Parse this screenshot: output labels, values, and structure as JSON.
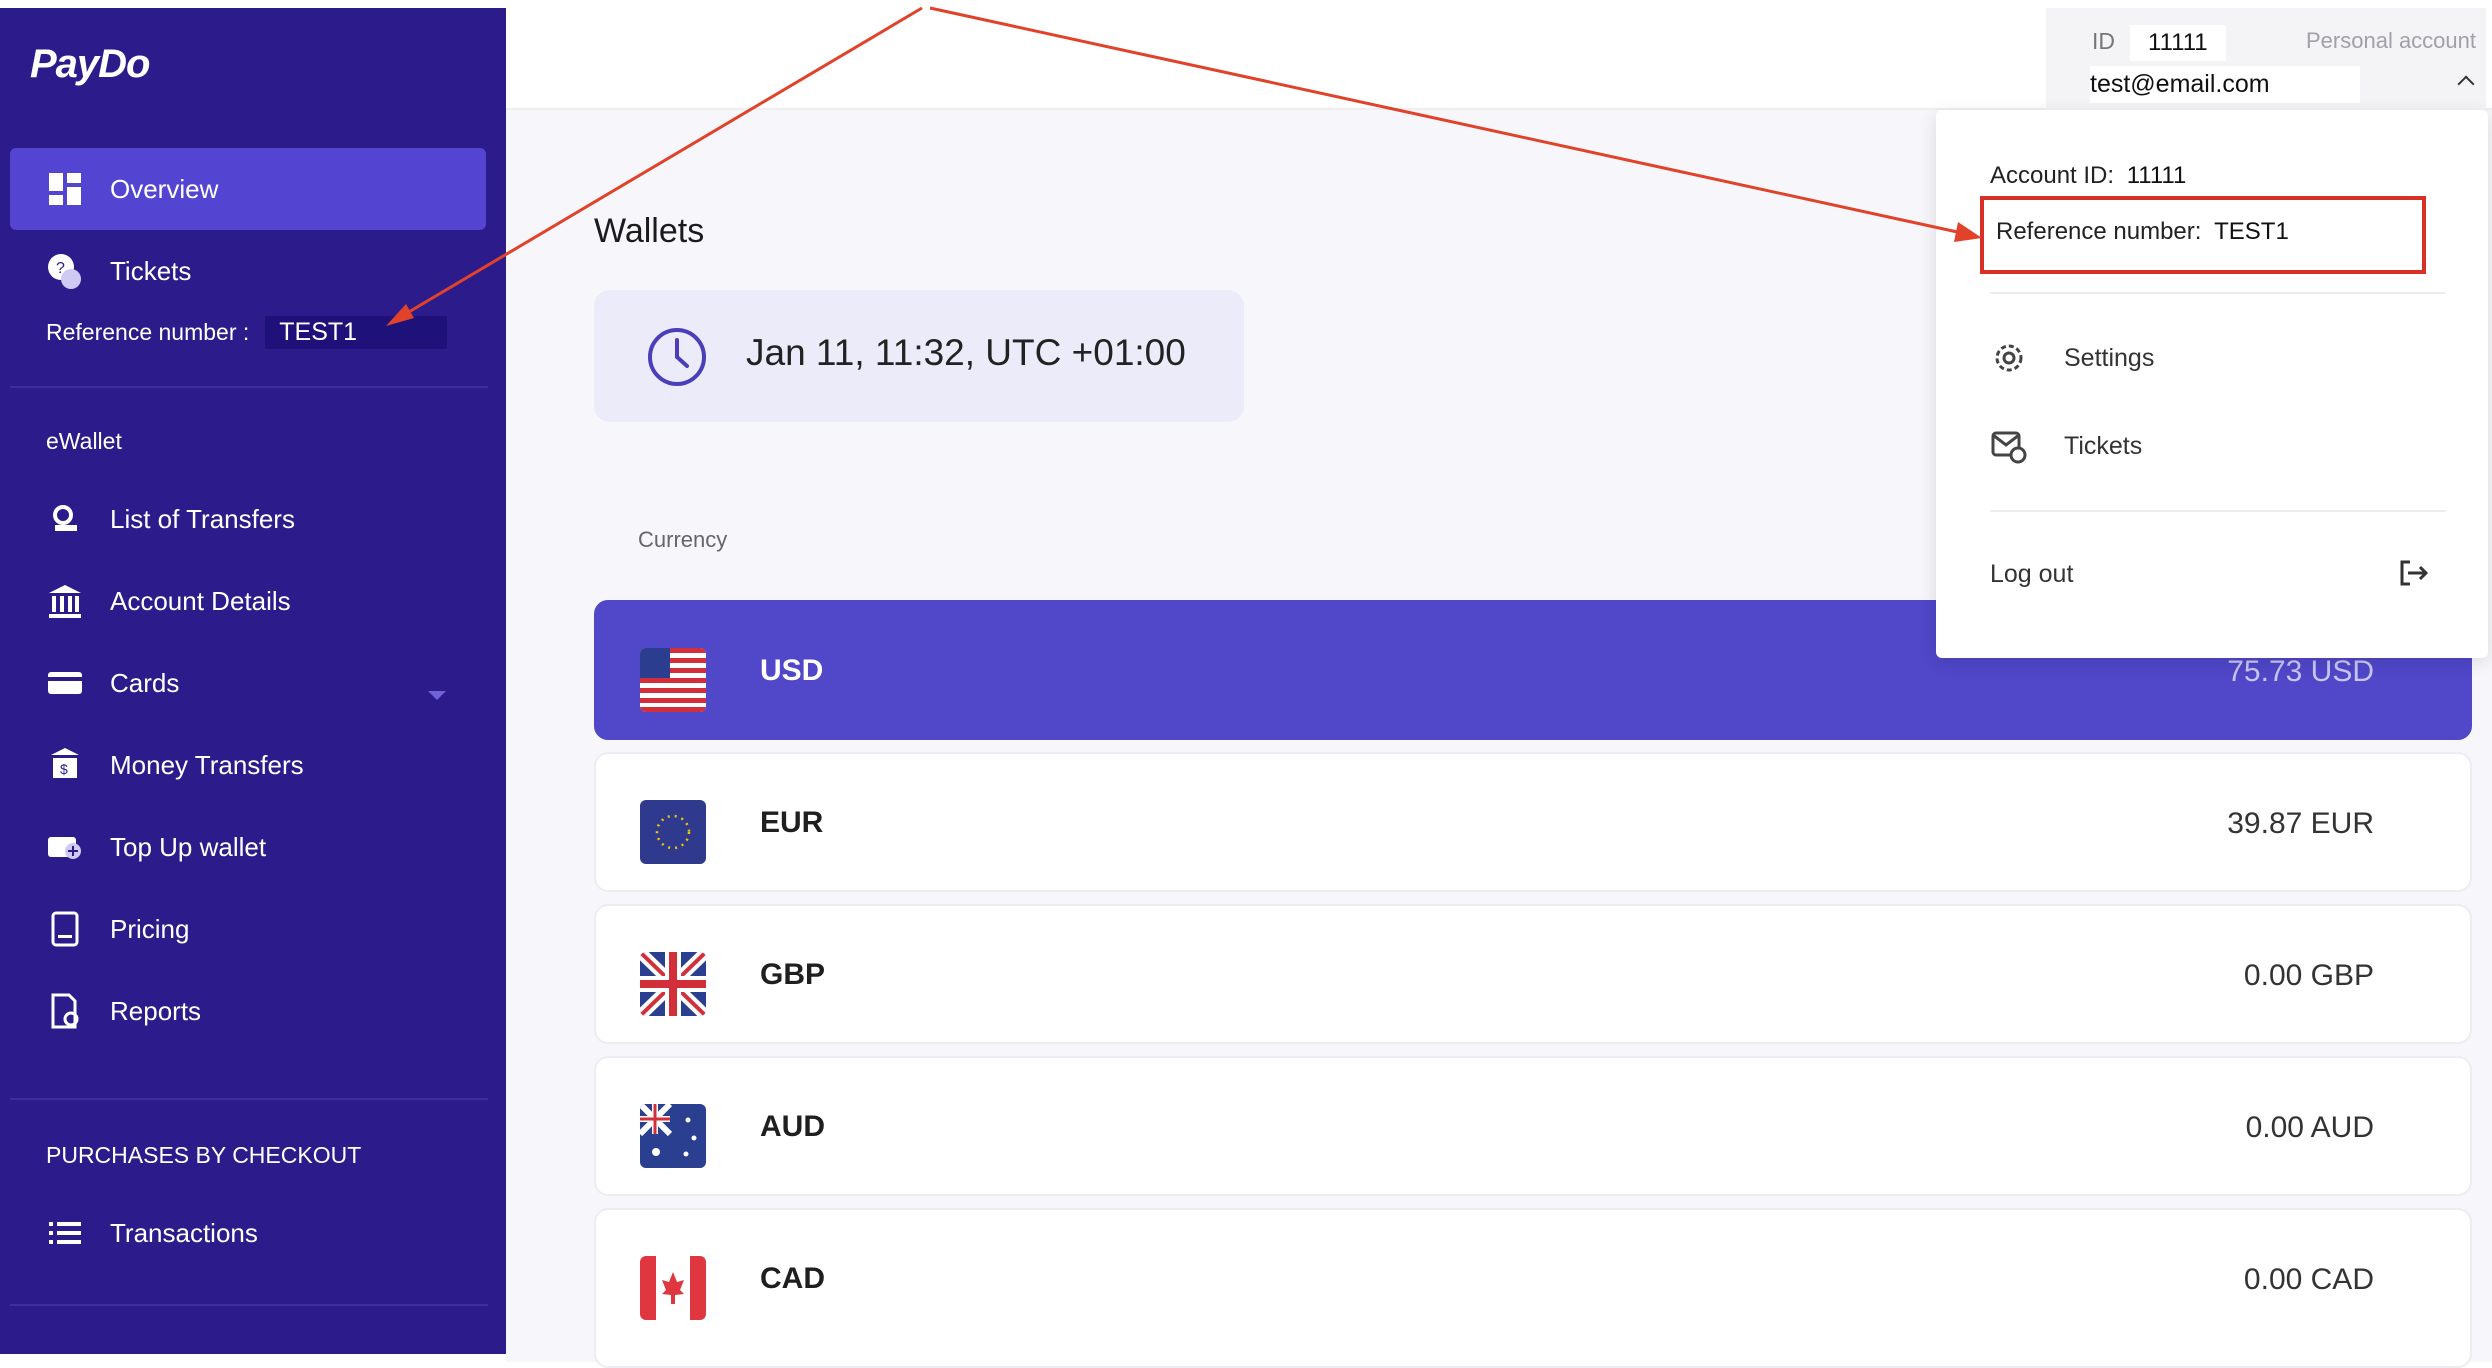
{
  "sidebar": {
    "logo": "PayDo",
    "nav_top": [
      {
        "label": "Overview",
        "icon": "dashboard-icon",
        "active": true
      },
      {
        "label": "Tickets",
        "icon": "help-chat-icon",
        "active": false
      }
    ],
    "reference": {
      "label": "Reference number :",
      "value": "TEST1"
    },
    "ewallet_label": "eWallet",
    "ewallet_items": [
      {
        "label": "List of Transfers",
        "icon": "transfers-list-icon"
      },
      {
        "label": "Account Details",
        "icon": "bank-icon"
      },
      {
        "label": "Cards",
        "icon": "card-icon"
      },
      {
        "label": "Money Transfers",
        "icon": "money-transfer-icon"
      },
      {
        "label": "Top Up wallet",
        "icon": "top-up-icon"
      },
      {
        "label": "Pricing",
        "icon": "pricing-icon"
      },
      {
        "label": "Reports",
        "icon": "reports-icon"
      }
    ],
    "checkout_label": "PURCHASES BY CHECKOUT",
    "checkout_items": [
      {
        "label": "Transactions",
        "icon": "list-icon"
      }
    ]
  },
  "header": {
    "id_label": "ID",
    "id_value": "11111",
    "account_type": "Personal account",
    "email": "test@email.com"
  },
  "dropdown": {
    "account_id_label": "Account ID:",
    "account_id_value": "11111",
    "reference_label": "Reference number:",
    "reference_value": "TEST1",
    "settings": "Settings",
    "tickets": "Tickets",
    "logout": "Log out"
  },
  "main": {
    "title": "Wallets",
    "datetime": "Jan 11, 11:32, UTC +01:00",
    "currency_header": "Currency",
    "wallets": [
      {
        "code": "USD",
        "amount": "75.73 USD",
        "flag": "us-flag-icon",
        "active": true
      },
      {
        "code": "EUR",
        "amount": "39.87 EUR",
        "flag": "eu-flag-icon",
        "active": false
      },
      {
        "code": "GBP",
        "amount": "0.00 GBP",
        "flag": "uk-flag-icon",
        "active": false
      },
      {
        "code": "AUD",
        "amount": "0.00 AUD",
        "flag": "au-flag-icon",
        "active": false
      },
      {
        "code": "CAD",
        "amount": "0.00 CAD",
        "flag": "ca-flag-icon",
        "active": false
      }
    ]
  },
  "colors": {
    "sidebar_bg": "#2c1b8a",
    "active_nav": "#5345d2",
    "active_wallet": "#5047c9",
    "annotation": "#e0422a"
  }
}
